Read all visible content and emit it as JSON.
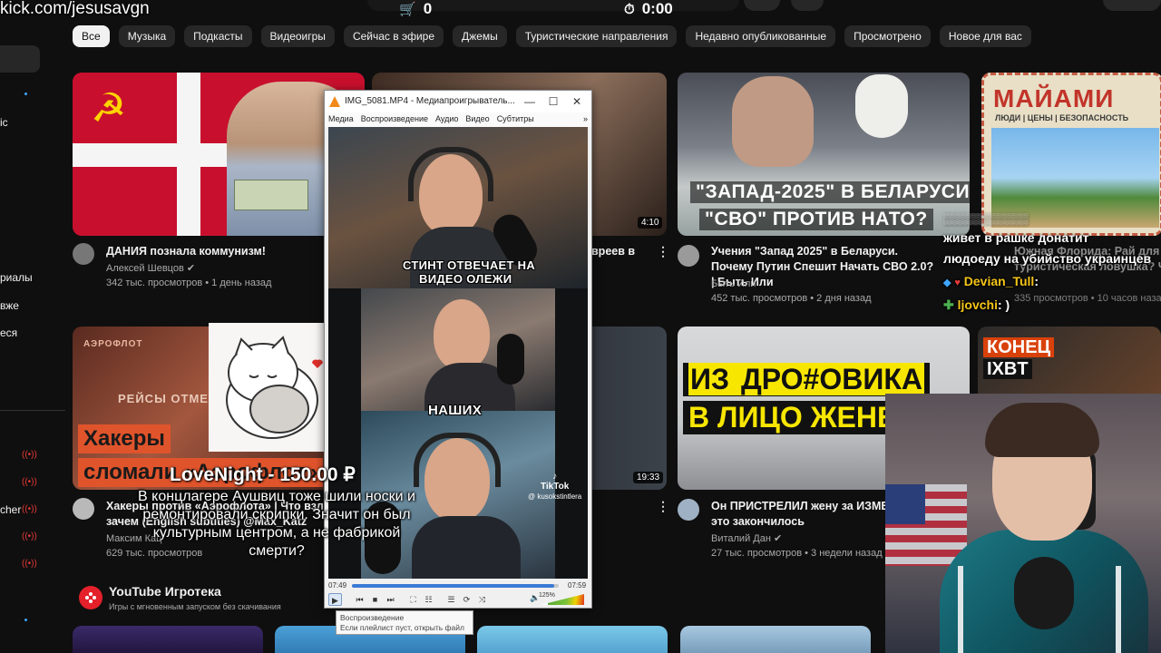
{
  "overlay": {
    "channel_url": "kick.com/jesusavgn",
    "counter_value": "0",
    "timer_value": "0:00"
  },
  "sidebar": {
    "fragments": [
      "ic",
      "риалы",
      "вже",
      "еся",
      "cher"
    ]
  },
  "chips": [
    "Все",
    "Музыка",
    "Подкасты",
    "Видеоигры",
    "Сейчас в эфире",
    "Джемы",
    "Туристические направления",
    "Недавно опубликованные",
    "Просмотрено",
    "Новое для вас"
  ],
  "videos": [
    {
      "title": "ДАНИЯ познала коммунизм!",
      "channel": "Алексей Шевцов",
      "meta": "342 тыс. просмотров • 1 день назад",
      "verified": true
    },
    {
      "title_fragment": "вреев в",
      "duration": "4:10"
    },
    {
      "title": "Учения \"Запад 2025\" в Беларуси. Почему Путин Спешит Начать СВО 2.0? | Быть Или",
      "channel": "Быть Или",
      "meta": "452 тыс. просмотров • 2 дня назад",
      "thumb_text_1": "\"ЗАПАД-2025\" В БЕЛАРУСИ",
      "thumb_text_2": "\"СВО\" ПРОТИВ НАТО?"
    },
    {
      "title_fragment": "Южная Флорида: Рай для жи",
      "title_fragment_2": "туристическая ловушка? Че",
      "meta_fragment": "335 просмотров • 10 часов назад",
      "thumb_title": "МАЙАМИ",
      "thumb_sub": "ЛЮДИ | ЦЕНЫ | БЕЗОПАСНОСТЬ"
    },
    {
      "title": "Хакеры против «Аэрофлота» | Что взлома",
      "title_2": "зачем (English subtitles) @Max_Katz",
      "channel": "Максим Кац",
      "meta": "629 тыс. просмотров",
      "thumb_text_1": "Хакеры",
      "thumb_text_2": "сломали «Аэрофлот»",
      "thumb_text_3": "РЕЙСЫ ОТМЕНЕНЫ",
      "thumb_text_4": "АЭРОФЛОТ"
    },
    {
      "duration": "19:33"
    },
    {
      "title": "Он ПРИСТРЕЛИЛ жену за ИЗМЕН",
      "title_2": "это закончилось",
      "channel": "Виталий Дан",
      "meta": "27 тыс. просмотров • 3 недели назад",
      "verified": true,
      "thumb_text_1": "ИЗ ",
      "thumb_text_highlight": "ДРО#ОВИКА",
      "thumb_text_2": "В ЛИЦО ЖЕНЕ"
    },
    {
      "thumb_text_1": "КОНЕЦ",
      "thumb_text_2": "IXBT"
    }
  ],
  "player": {
    "window_title": "IMG_5081.MP4 - Медиапроигрыватель...",
    "menu": [
      "Медиа",
      "Воспроизведение",
      "Аудио",
      "Видео",
      "Субтитры",
      "»"
    ],
    "caption_1": "СТИНТ ОТВЕЧАЕТ НА",
    "caption_2": "ВИДЕО ОЛЕЖИ",
    "caption_3": "НАШИХ",
    "tiktok_label": "TikTok",
    "tiktok_user": "@ kusokstintlera",
    "time_elapsed": "07:49",
    "time_total": "07:59",
    "progress": 0.98,
    "volume": "125%",
    "tooltip_1": "Воспроизведение",
    "tooltip_2": "Если плейлист пуст, открыть файл"
  },
  "donation": {
    "title": "LoveNight - 150.00 ₽",
    "message": "В концлагере Аушвиц тоже шили носки и ремонтировали скрипки. Значит он был культурным центром, а не фабрикой смерти?"
  },
  "chat": {
    "top_text_1": "живет в рашке донатит",
    "top_text_2": "людоеду на убийство украинцев",
    "messages": [
      {
        "user": "Devian_Tull",
        "text": ":",
        "color": "#f5c518"
      },
      {
        "user": "ljovchi",
        "text": ": )",
        "color": "#f5c518"
      }
    ]
  },
  "gaming": {
    "title": "YouTube Игротека",
    "subtitle": "Игры с мгновенным запуском без скачивания"
  },
  "colors": {
    "bg": "#0f0f0f",
    "chip": "#272727",
    "accent_red": "#e4202a",
    "live_red": "#e53935"
  }
}
